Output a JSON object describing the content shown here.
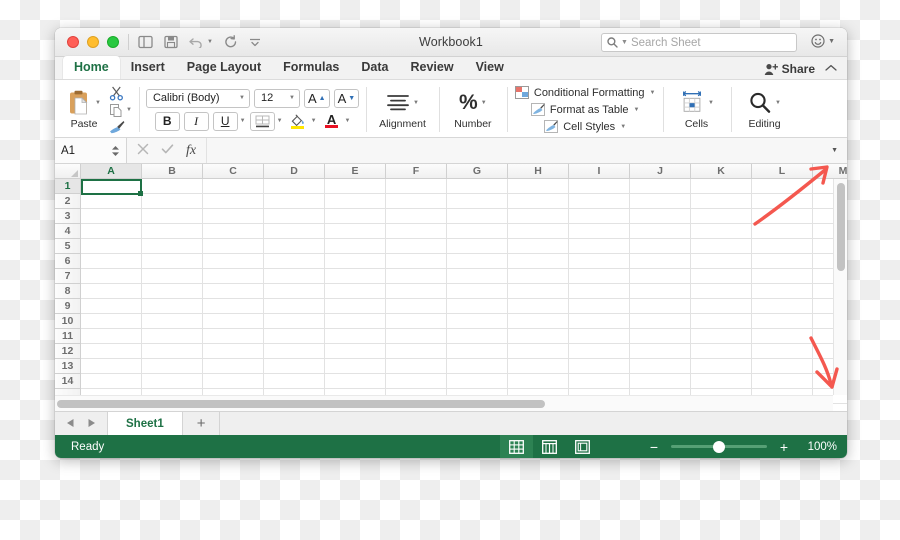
{
  "window": {
    "title": "Workbook1",
    "traffic_lights": [
      "close",
      "minimize",
      "zoom"
    ],
    "quick_access": [
      "sidebar-icon",
      "save-icon",
      "undo-icon",
      "redo-icon",
      "overflow-icon"
    ]
  },
  "search": {
    "placeholder": "Search Sheet",
    "icon": "search-icon"
  },
  "account": {
    "icon": "smiley-face-icon"
  },
  "ribbon_tabs": [
    {
      "label": "Home",
      "active": true
    },
    {
      "label": "Insert",
      "active": false
    },
    {
      "label": "Page Layout",
      "active": false
    },
    {
      "label": "Formulas",
      "active": false
    },
    {
      "label": "Data",
      "active": false
    },
    {
      "label": "Review",
      "active": false
    },
    {
      "label": "View",
      "active": false
    }
  ],
  "share": {
    "label": "Share",
    "icon": "person-add-icon",
    "collapse_icon": "chevron-up-icon"
  },
  "ribbon": {
    "paste": {
      "label": "Paste",
      "icon": "clipboard-icon"
    },
    "clipboard": {
      "cut": "scissors-icon",
      "copy": "copy-icon",
      "format_painter": "paintbrush-icon"
    },
    "font": {
      "family": "Calibri (Body)",
      "size": "12",
      "grow_label": "A",
      "shrink_label": "A",
      "bold": "B",
      "italic": "I",
      "underline": "U",
      "borders_icon": "borders-icon",
      "fill_color": "#ffe600",
      "font_color": "#e81123",
      "fill_icon": "fill-color-icon",
      "font_color_icon": "font-color-icon"
    },
    "alignment": {
      "label": "Alignment",
      "icon": "align-lines-icon"
    },
    "number": {
      "label": "Number",
      "glyph": "%"
    },
    "styles": [
      {
        "label": "Conditional Formatting",
        "icon": "conditional-formatting-icon"
      },
      {
        "label": "Format as Table",
        "icon": "format-as-table-icon"
      },
      {
        "label": "Cell Styles",
        "icon": "cell-styles-icon"
      }
    ],
    "cells": {
      "label": "Cells",
      "icon": "cells-icon"
    },
    "editing": {
      "label": "Editing",
      "icon": "magnifier-icon"
    }
  },
  "formula_bar": {
    "name_box": "A1",
    "cancel_icon": "close-icon",
    "confirm_icon": "check-icon",
    "function_icon": "fx",
    "value": "",
    "expand_icon": "chevron-down-icon"
  },
  "grid": {
    "columns": [
      "A",
      "B",
      "C",
      "D",
      "E",
      "F",
      "G",
      "H",
      "I",
      "J",
      "K",
      "L",
      "M"
    ],
    "rows": [
      "1",
      "2",
      "3",
      "4",
      "5",
      "6",
      "7",
      "8",
      "9",
      "10",
      "11",
      "12",
      "13",
      "14"
    ],
    "selected_cell": "A1",
    "selection_color": "#1e7145"
  },
  "annotations": [
    {
      "name": "arrow-to-scrollbar-top",
      "color": "#f4584f",
      "direction": "up-right"
    },
    {
      "name": "arrow-to-scrollbar-bottom",
      "color": "#f4584f",
      "direction": "down"
    }
  ],
  "sheet_tabs": {
    "prev_icon": "triangle-left-icon",
    "next_icon": "triangle-right-icon",
    "tabs": [
      {
        "label": "Sheet1",
        "active": true
      }
    ],
    "add_label": "+"
  },
  "status_bar": {
    "status": "Ready",
    "views": [
      {
        "name": "normal-view",
        "icon": "grid-view-icon",
        "active": true
      },
      {
        "name": "page-layout-view",
        "icon": "page-layout-icon",
        "active": false
      },
      {
        "name": "page-break-view",
        "icon": "page-break-icon",
        "active": false
      }
    ],
    "zoom_out": "−",
    "zoom_in": "+",
    "zoom_value": "100%",
    "accent_color": "#1e7145"
  }
}
